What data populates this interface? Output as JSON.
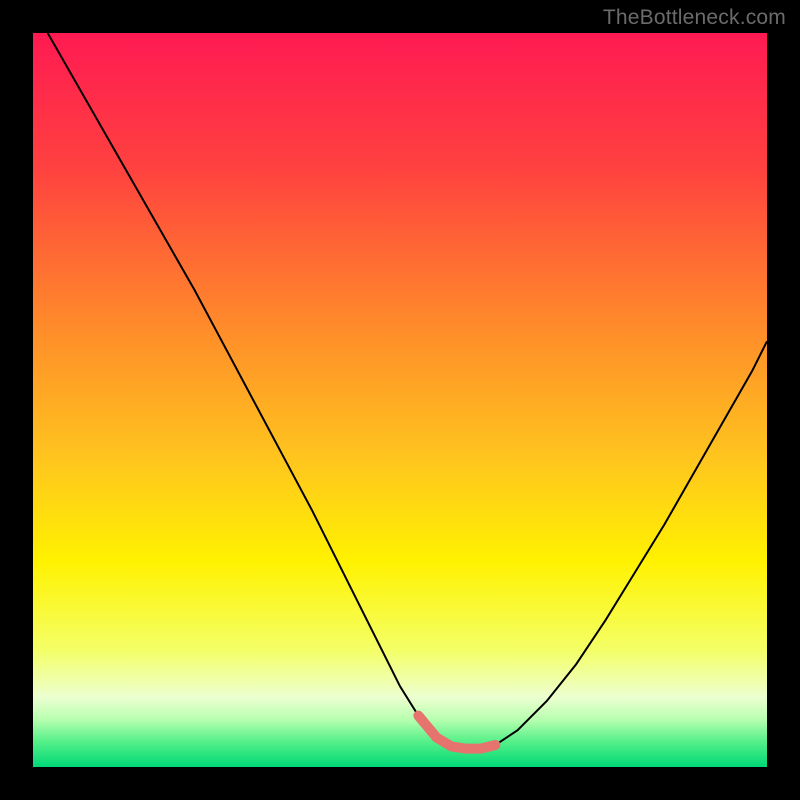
{
  "watermark": "TheBottleneck.com",
  "chart_data": {
    "type": "line",
    "title": "",
    "xlabel": "",
    "ylabel": "",
    "xlim": [
      0,
      100
    ],
    "ylim": [
      0,
      100
    ],
    "grid": false,
    "legend": false,
    "background_gradient_stops": [
      {
        "offset": 0.0,
        "color": "#ff1a52"
      },
      {
        "offset": 0.18,
        "color": "#ff4040"
      },
      {
        "offset": 0.4,
        "color": "#ff8b2a"
      },
      {
        "offset": 0.58,
        "color": "#ffc51e"
      },
      {
        "offset": 0.72,
        "color": "#fff200"
      },
      {
        "offset": 0.84,
        "color": "#f4ff66"
      },
      {
        "offset": 0.905,
        "color": "#ecffd0"
      },
      {
        "offset": 0.935,
        "color": "#b8ffb0"
      },
      {
        "offset": 0.965,
        "color": "#56f089"
      },
      {
        "offset": 1.0,
        "color": "#00d877"
      }
    ],
    "series": [
      {
        "name": "bottleneck-curve",
        "color": "#000000",
        "width": 2,
        "x": [
          2,
          6,
          10,
          14,
          18,
          22,
          26,
          30,
          34,
          38,
          42,
          46,
          50,
          52.5,
          55,
          57,
          59,
          61,
          63,
          66,
          70,
          74,
          78,
          82,
          86,
          90,
          94,
          98,
          100
        ],
        "y": [
          100,
          93,
          86,
          79,
          72,
          65,
          57.5,
          50,
          42.5,
          35,
          27,
          19,
          11,
          7,
          4,
          2.8,
          2.5,
          2.5,
          3,
          5,
          9,
          14,
          20,
          26.5,
          33,
          40,
          47,
          54,
          58
        ]
      },
      {
        "name": "sweet-spot-marker",
        "color": "#e6736e",
        "width": 10,
        "linecap": "round",
        "x": [
          52.5,
          55,
          57,
          59,
          61,
          63
        ],
        "y": [
          7,
          4,
          2.8,
          2.5,
          2.5,
          3
        ]
      }
    ]
  }
}
